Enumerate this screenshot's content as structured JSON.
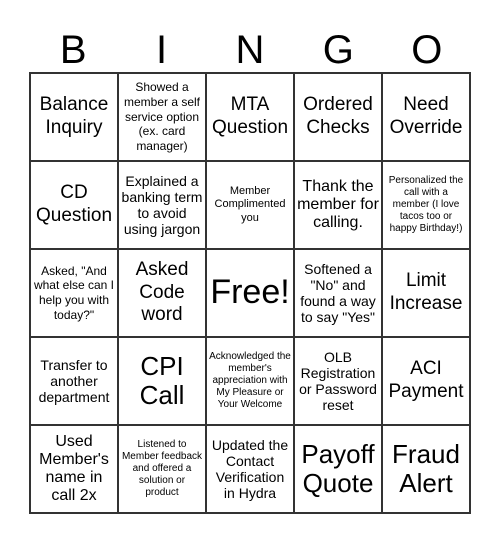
{
  "header": {
    "letters": [
      "B",
      "I",
      "N",
      "G",
      "O"
    ]
  },
  "cells": [
    [
      "Balance Inquiry",
      "Showed a member a self service option (ex. card manager)",
      "MTA Question",
      "Ordered Checks",
      "Need Override"
    ],
    [
      "CD Question",
      "Explained a banking term to avoid using jargon",
      "Member Complimented you",
      "Thank the member for calling.",
      "Personalized the call with a member (I love tacos too or happy Birthday!)"
    ],
    [
      "Asked, \"And what else can I help you with today?\"",
      "Asked Code word",
      "Free!",
      "Softened a \"No\" and found a way to say \"Yes\"",
      "Limit Increase"
    ],
    [
      "Transfer to another department",
      "CPI Call",
      "Acknowledged the member's appreciation with My Pleasure or Your Welcome",
      "OLB Registration or Password reset",
      "ACI Payment"
    ],
    [
      "Used Member's name in call 2x",
      "Listened to Member feedback and offered a solution or product",
      "Updated the Contact Verification in Hydra",
      "Payoff Quote",
      "Fraud Alert"
    ]
  ],
  "colors": {
    "border": "#333333",
    "text": "#000000",
    "background": "#ffffff"
  }
}
